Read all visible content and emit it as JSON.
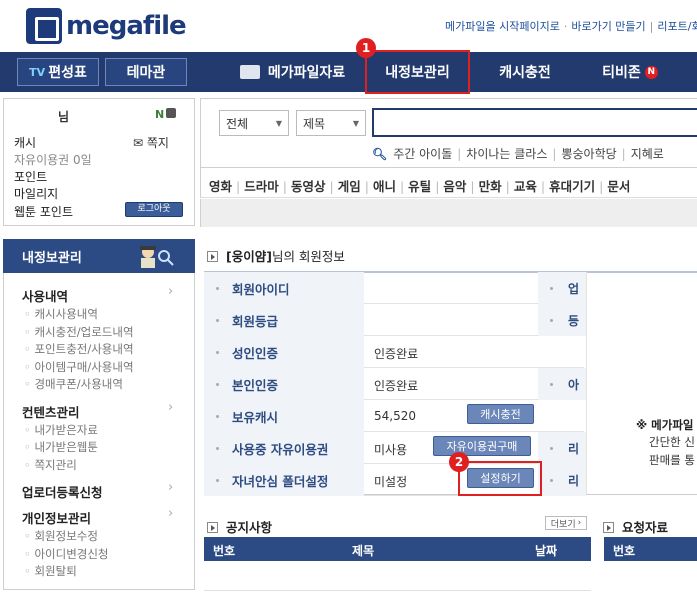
{
  "header": {
    "logo_text": "megafile",
    "top_links": [
      "메가파일을 시작페이지로",
      "바로가기 만들기",
      "리포트/회원"
    ]
  },
  "nav": {
    "tv_label": "TV",
    "schedule_label": "편성표",
    "theme_label": "테마관",
    "items": [
      "메가파일자료",
      "내정보관리",
      "캐시충전",
      "티비존"
    ],
    "tvzone_badge": "N"
  },
  "badges": {
    "one": "1",
    "two": "2"
  },
  "user": {
    "name": "님",
    "n_label": "N",
    "cash_label": "캐시",
    "message_label": "쪽지",
    "free_pass": "자유이용권 0일",
    "point_label": "포인트",
    "mileage_label": "마일리지",
    "webtoon_point_label": "웹툰 포인트",
    "logout_label": "로그아웃"
  },
  "search": {
    "select1": "전체",
    "select2": "제목",
    "input_value": "",
    "popular": [
      "주간 아이돌",
      "차이나는 클라스",
      "뽕숭아학당",
      "지혜로"
    ],
    "categories": [
      "영화",
      "드라마",
      "동영상",
      "게임",
      "애니",
      "유틸",
      "음악",
      "만화",
      "교육",
      "휴대기기",
      "문서"
    ]
  },
  "menu": {
    "title": "내정보관리",
    "sections": [
      {
        "title": "사용내역",
        "items": [
          "캐시사용내역",
          "캐시충전/업로드내역",
          "포인트충전/사용내역",
          "아이템구매/사용내역",
          "경매쿠폰/사용내역"
        ]
      },
      {
        "title": "컨텐츠관리",
        "items": [
          "내가받은자료",
          "내가받은웹툰",
          "쪽지관리"
        ]
      },
      {
        "title": "업로더등록신청",
        "items": []
      },
      {
        "title": "개인정보관리",
        "items": [
          "회원정보수정",
          "아이디변경신청",
          "회원탈퇴"
        ]
      }
    ]
  },
  "info": {
    "title_user": "[웅이얌]",
    "title_suffix": "님의 회원정보",
    "rows": [
      {
        "label": "회원아이디",
        "value": ""
      },
      {
        "label": "회원등급",
        "value": ""
      },
      {
        "label": "성인인증",
        "value": "인증완료"
      },
      {
        "label": "본인인증",
        "value": "인증완료"
      },
      {
        "label": "보유캐시",
        "value": "54,520"
      },
      {
        "label": "사용중 자유이용권",
        "value": "미사용"
      },
      {
        "label": "자녀안심 폴더설정",
        "value": "미설정"
      }
    ],
    "buttons": {
      "cash": "캐시충전",
      "freepass": "자유이용권구매",
      "setting": "설정하기"
    },
    "right_labels": [
      "업",
      "등",
      "아",
      "리",
      "리"
    ],
    "note_title": "※ 메가파일",
    "note_line1": "간단한 신",
    "note_line2": "판매를 통"
  },
  "notice": {
    "title": "공지사항",
    "more": "더보기",
    "headers": [
      "번호",
      "제목",
      "날짜"
    ]
  },
  "request": {
    "title": "요청자료",
    "headers": [
      "번호"
    ]
  }
}
